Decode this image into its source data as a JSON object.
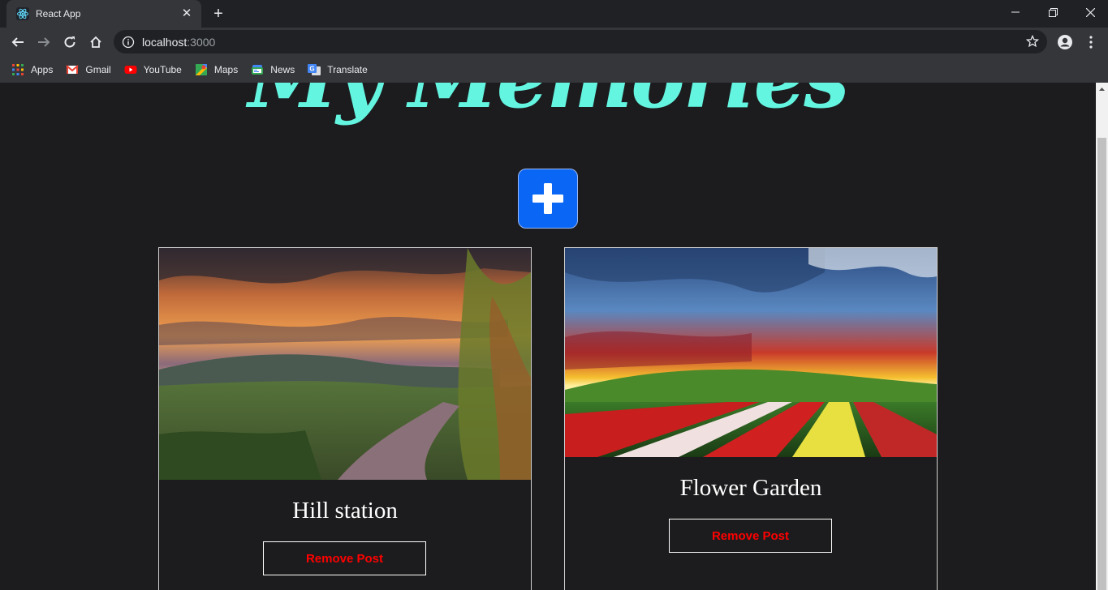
{
  "browser": {
    "tab_title": "React App",
    "url_host": "localhost",
    "url_port": ":3000",
    "bookmarks": [
      {
        "label": "Apps",
        "icon": "apps-grid-icon"
      },
      {
        "label": "Gmail",
        "icon": "gmail-icon"
      },
      {
        "label": "YouTube",
        "icon": "youtube-icon"
      },
      {
        "label": "Maps",
        "icon": "maps-icon"
      },
      {
        "label": "News",
        "icon": "news-icon"
      },
      {
        "label": "Translate",
        "icon": "translate-icon"
      }
    ]
  },
  "page": {
    "heading": "My Memories",
    "heading_color": "#64f5e1",
    "add_button_color": "#0a66f5",
    "add_button_icon": "plus-icon",
    "posts": [
      {
        "title": "Hill station",
        "remove_label": "Remove Post",
        "image": "sunset-hill-path-photo"
      },
      {
        "title": "Flower Garden",
        "remove_label": "Remove Post",
        "image": "flower-field-sunset-photo"
      }
    ]
  }
}
